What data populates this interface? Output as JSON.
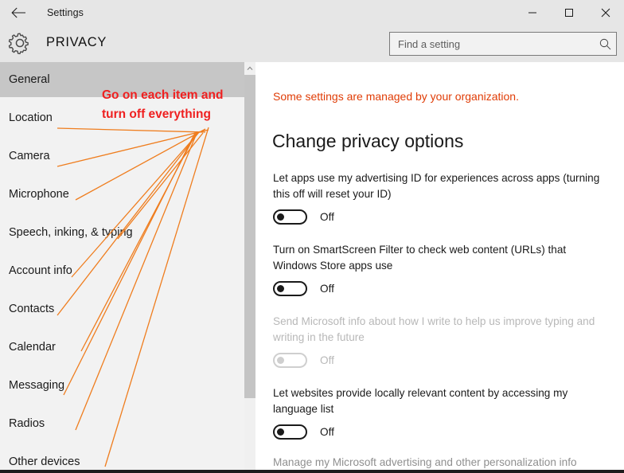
{
  "window": {
    "app_title": "Settings",
    "back_icon": "back-arrow-icon",
    "minimize_label": "Minimize",
    "maximize_label": "Maximize",
    "close_label": "Close"
  },
  "header": {
    "page_title": "PRIVACY",
    "gear_icon": "gear-icon",
    "search": {
      "placeholder": "Find a setting",
      "value": "",
      "icon": "search-icon"
    }
  },
  "sidebar": {
    "items": [
      {
        "label": "General",
        "selected": true
      },
      {
        "label": "Location",
        "selected": false
      },
      {
        "label": "Camera",
        "selected": false
      },
      {
        "label": "Microphone",
        "selected": false
      },
      {
        "label": "Speech, inking, & typing",
        "selected": false
      },
      {
        "label": "Account info",
        "selected": false
      },
      {
        "label": "Contacts",
        "selected": false
      },
      {
        "label": "Calendar",
        "selected": false
      },
      {
        "label": "Messaging",
        "selected": false
      },
      {
        "label": "Radios",
        "selected": false
      },
      {
        "label": "Other devices",
        "selected": false
      }
    ],
    "scrollbar": {
      "up_arrow_icon": "chevron-up-icon"
    }
  },
  "main": {
    "org_notice": "Some settings are managed by your organization.",
    "section_title": "Change privacy options",
    "options": [
      {
        "label": "Let apps use my advertising ID for experiences across apps (turning this off will reset your ID)",
        "state": "Off",
        "disabled": false
      },
      {
        "label": "Turn on SmartScreen Filter to check web content (URLs) that Windows Store apps use",
        "state": "Off",
        "disabled": false
      },
      {
        "label": "Send Microsoft info about how I write to help us improve typing and writing in the future",
        "state": "Off",
        "disabled": true
      },
      {
        "label": "Let websites provide locally relevant content by accessing my language list",
        "state": "Off",
        "disabled": false
      }
    ],
    "footer_link": "Manage my Microsoft advertising and other personalization info"
  },
  "annotation": {
    "line1": "Go on each item and",
    "line2": "turn off everything",
    "text_color": "#ef2020",
    "arrow_color": "#ef7d1e"
  }
}
